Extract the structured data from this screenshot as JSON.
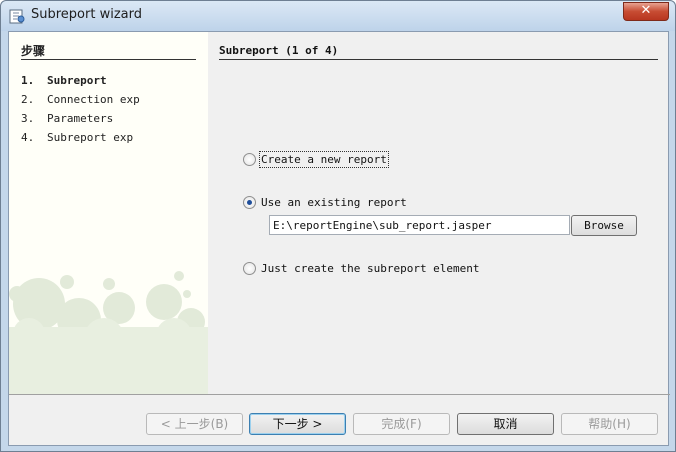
{
  "window": {
    "title": "Subreport wizard"
  },
  "steps": {
    "title": "步骤",
    "items": [
      {
        "num": "1.",
        "label": "Subreport",
        "active": true
      },
      {
        "num": "2.",
        "label": "Connection exp",
        "active": false
      },
      {
        "num": "3.",
        "label": "Parameters",
        "active": false
      },
      {
        "num": "4.",
        "label": "Subreport exp",
        "active": false
      }
    ]
  },
  "content": {
    "title": "Subreport (1 of 4)",
    "options": {
      "create_new": {
        "label": "Create a new report",
        "checked": false
      },
      "use_existing": {
        "label": "Use an existing report",
        "checked": true
      },
      "just_create": {
        "label": "Just create the subreport element",
        "checked": false
      }
    },
    "path_value": "E:\\reportEngine\\sub_report.jasper",
    "browse_label": "Browse"
  },
  "footer": {
    "back": "< 上一步(B)",
    "next": "下一步 >",
    "finish": "完成(F)",
    "cancel": "取消",
    "help": "帮助(H)"
  },
  "colors": {
    "title_bar": "#c4d7ea",
    "close_button": "#c74c33",
    "radio_dot": "#1f4e9a"
  }
}
